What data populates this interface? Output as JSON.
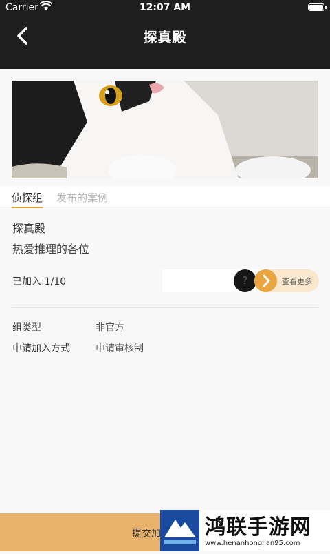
{
  "status_bar": {
    "carrier": "Carrier",
    "time": "12:07 AM"
  },
  "header": {
    "title": "探真殿"
  },
  "tabs": [
    {
      "label": "侦探组",
      "active": true
    },
    {
      "label": "发布的案例",
      "active": false
    }
  ],
  "group": {
    "name": "探真殿",
    "description": "热爱推理的各位",
    "joined": "已加入:1/10",
    "member_avatar_text": "?",
    "see_more_label": "查看更多"
  },
  "details": [
    {
      "label": "组类型",
      "value": "非官方"
    },
    {
      "label": "申请加入方式",
      "value": "申请审核制"
    }
  ],
  "bottom_button": {
    "label": "提交加入申请"
  },
  "watermark": {
    "title": "鸿联手游网",
    "url": "www.henanhonglian95.com"
  },
  "colors": {
    "accent": "#e9a640",
    "header_bg": "#1e1e1e",
    "bottom_bar": "#e9b26b"
  }
}
